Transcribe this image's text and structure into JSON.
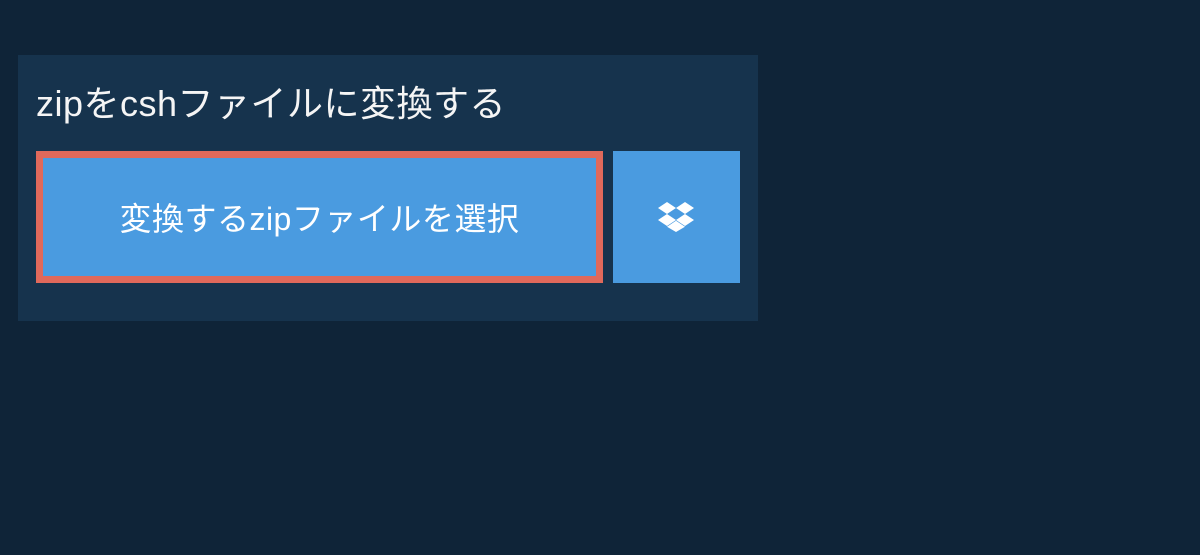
{
  "header": {
    "title": "zipをcshファイルに変換する"
  },
  "actions": {
    "select_file_label": "変換するzipファイルを選択",
    "dropbox_icon": "dropbox-icon"
  },
  "colors": {
    "page_bg": "#0f2438",
    "panel_bg": "#16334d",
    "button_bg": "#4a9be0",
    "button_border": "#e0695b",
    "text": "#ffffff"
  }
}
